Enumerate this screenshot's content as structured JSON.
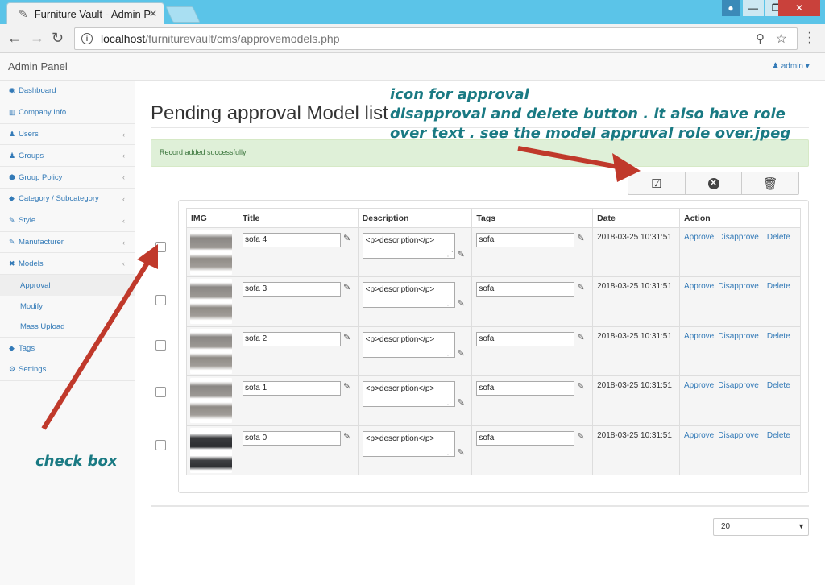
{
  "browser": {
    "tab_title": "Furniture Vault - Admin P",
    "url_host": "localhost",
    "url_path": "/furniturevault/cms/approvemodels.php"
  },
  "app": {
    "brand": "Admin Panel",
    "user": "admin"
  },
  "sidebar": {
    "items": [
      {
        "label": "Dashboard",
        "icon": "dashboard-icon",
        "has_children": false
      },
      {
        "label": "Company Info",
        "icon": "building-icon",
        "has_children": false
      },
      {
        "label": "Users",
        "icon": "users-icon",
        "has_children": true
      },
      {
        "label": "Groups",
        "icon": "users-icon",
        "has_children": true
      },
      {
        "label": "Group Policy",
        "icon": "policy-icon",
        "has_children": true
      },
      {
        "label": "Category / Subcategory",
        "icon": "tags-icon",
        "has_children": true
      },
      {
        "label": "Style",
        "icon": "tag-icon",
        "has_children": true
      },
      {
        "label": "Manufacturer",
        "icon": "tag-icon",
        "has_children": true
      },
      {
        "label": "Models",
        "icon": "cubes-icon",
        "has_children": true
      }
    ],
    "models_sub": [
      {
        "label": "Approval",
        "active": true
      },
      {
        "label": "Modify",
        "active": false
      },
      {
        "label": "Mass Upload",
        "active": false
      }
    ],
    "bottom_items": [
      {
        "label": "Tags",
        "icon": "tags-icon"
      },
      {
        "label": "Settings",
        "icon": "cogs-icon"
      }
    ]
  },
  "page": {
    "title": "Pending approval Model list",
    "alert": "Record added successfully"
  },
  "table": {
    "headers": [
      "IMG",
      "Title",
      "Description",
      "Tags",
      "Date",
      "Action"
    ],
    "actions": [
      "Approve",
      "Disapprove",
      "Delete"
    ],
    "rows": [
      {
        "title": "sofa 4",
        "description": "<p>description</p>",
        "tags": "sofa",
        "date": "2018-03-25 10:31:51"
      },
      {
        "title": "sofa 3",
        "description": "<p>description</p>",
        "tags": "sofa",
        "date": "2018-03-25 10:31:51"
      },
      {
        "title": "sofa 2",
        "description": "<p>description</p>",
        "tags": "sofa",
        "date": "2018-03-25 10:31:51"
      },
      {
        "title": "sofa 1",
        "description": "<p>description</p>",
        "tags": "sofa",
        "date": "2018-03-25 10:31:51"
      },
      {
        "title": "sofa 0",
        "description": "<p>description</p>",
        "tags": "sofa",
        "date": "2018-03-25 10:31:51"
      }
    ]
  },
  "pager": {
    "page_size": "20"
  },
  "annotations": {
    "top_lines": [
      "icon for approval",
      "disapproval and delete button . it also have role",
      "over text . see the model appruval role over.jpeg"
    ],
    "checkbox_note": "check box",
    "color": "#1a7a83",
    "arrow_color": "#c0392b"
  }
}
